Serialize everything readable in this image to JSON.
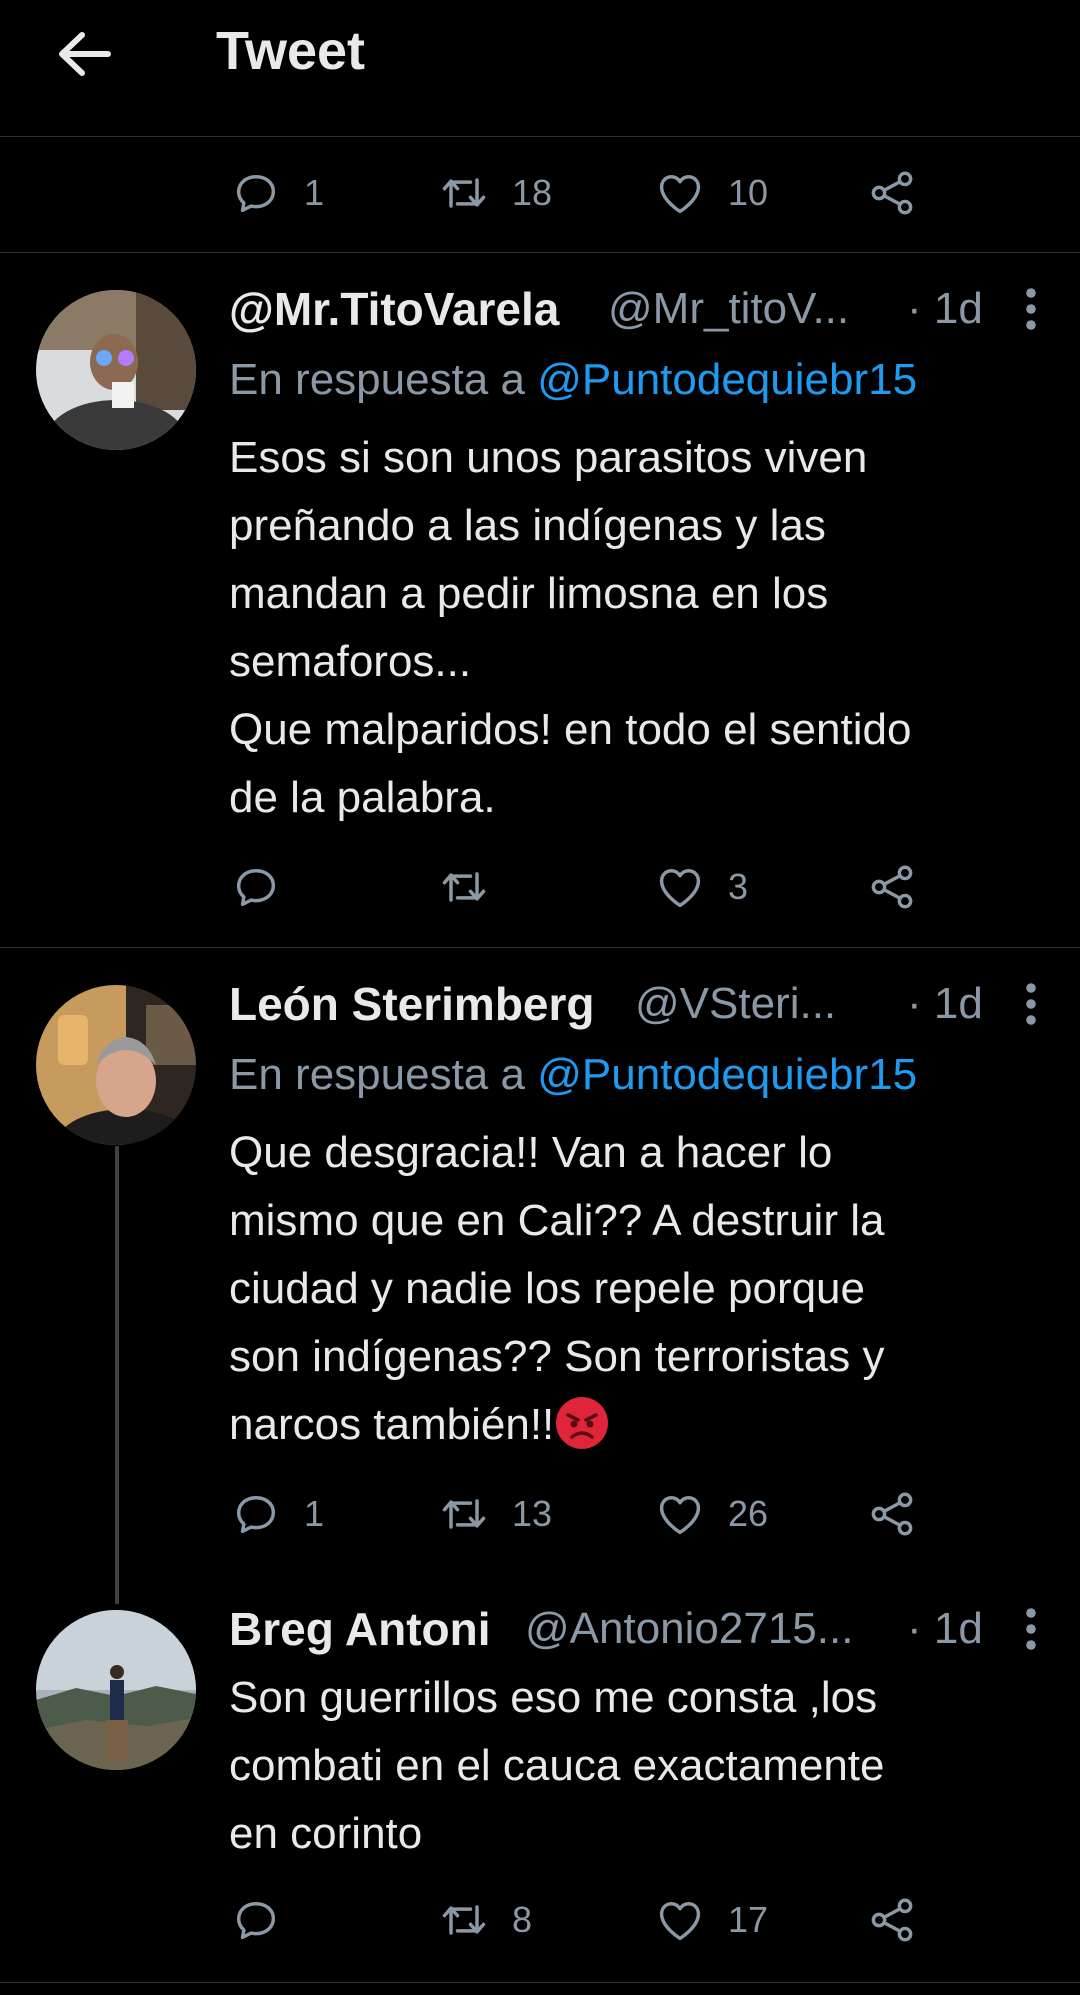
{
  "header": {
    "title": "Tweet",
    "back_icon": "arrow-left-icon"
  },
  "main_tweet_actions": {
    "replies": "1",
    "retweets": "18",
    "likes": "10"
  },
  "replies": [
    {
      "display_name": "@Mr.TitoVarela",
      "handle": "@Mr_titoV...",
      "time": "· 1d",
      "reply_prefix": "En respuesta a ",
      "reply_to": "@Puntodequiebr15",
      "text": "Esos si son unos parasitos viven\npreñando a las indígenas y las\nmandan a pedir limosna en los\nsemaforos...\nQue malparidos! en todo el sentido\nde la palabra.",
      "replies": "",
      "retweets": "",
      "likes": "3"
    },
    {
      "display_name": "León Sterimberg",
      "handle": "@VSteri...",
      "time": "· 1d",
      "reply_prefix": "En respuesta a ",
      "reply_to": "@Puntodequiebr15",
      "text": "Que desgracia!! Van a hacer lo\nmismo que en Cali?? A destruir la\nciudad y nadie los repele porque\nson indígenas?? Son terroristas y\nnarcos también!!",
      "emoji": "angry-face-emoji",
      "replies": "1",
      "retweets": "13",
      "likes": "26"
    },
    {
      "display_name": "Breg Antoni",
      "handle": "@Antonio2715...",
      "time": "· 1d",
      "text": "Son guerrillos eso me consta ,los\ncombati en el cauca exactamente\nen corinto",
      "replies": "",
      "retweets": "8",
      "likes": "17"
    }
  ],
  "colors": {
    "background": "#000000",
    "text": "#e7e9ea",
    "muted": "#8b98a5",
    "link": "#1d9bf0",
    "divider": "#2f3336"
  }
}
